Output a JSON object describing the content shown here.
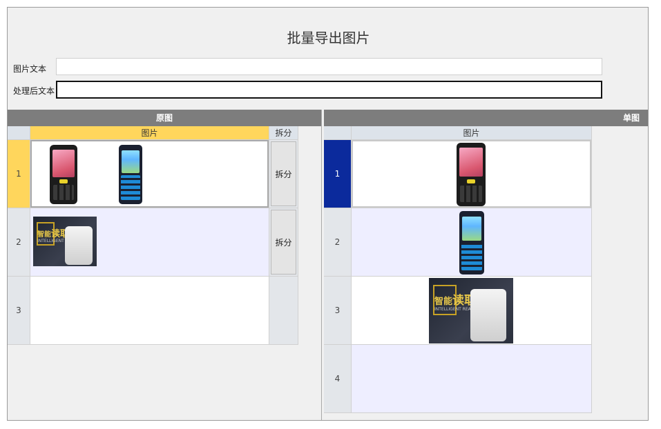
{
  "title": "批量导出图片",
  "form": {
    "image_text_label": "图片文本",
    "image_text_value": "",
    "processed_text_label": "处理后文本",
    "processed_text_value": ""
  },
  "left_panel": {
    "header": "原图",
    "columns": [
      "图片",
      "拆分"
    ],
    "rows": [
      {
        "index": "1",
        "split_label": "拆分"
      },
      {
        "index": "2",
        "split_label": "拆分"
      },
      {
        "index": "3",
        "split_label": ""
      }
    ]
  },
  "right_panel": {
    "header": "单图",
    "columns": [
      "图片"
    ],
    "rows": [
      {
        "index": "1"
      },
      {
        "index": "2"
      },
      {
        "index": "3"
      },
      {
        "index": "4"
      }
    ]
  },
  "ad_image": {
    "headline": "智能",
    "headline_big": "读取",
    "sub": "INTELLIGENT READING"
  },
  "colors": {
    "panel_header": "#7d7d7d",
    "selected_header": "#ffd65c",
    "selected_row_right": "#0b2a9c",
    "alt_row": "#eeeeff"
  },
  "icons": [
    "android-phone-image",
    "rugged-handheld-image",
    "card-reader-ad-image"
  ]
}
